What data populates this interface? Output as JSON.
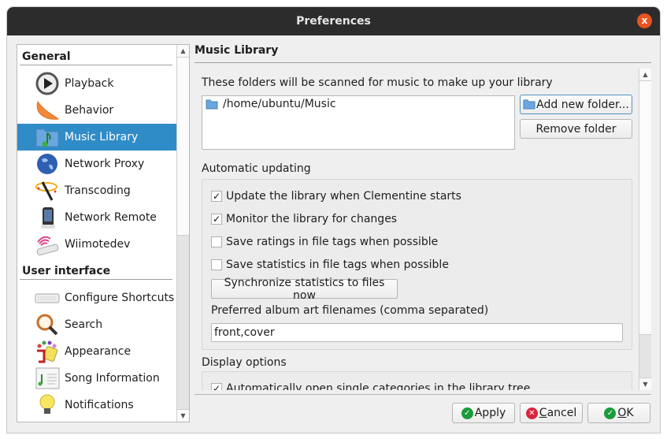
{
  "window": {
    "title": "Preferences",
    "close_label": "x"
  },
  "nav": {
    "groups": [
      {
        "label": "General",
        "items": [
          {
            "label": "Playback",
            "icon": "playback-icon"
          },
          {
            "label": "Behavior",
            "icon": "clementine-icon"
          },
          {
            "label": "Music Library",
            "icon": "music-folder-icon",
            "selected": true
          },
          {
            "label": "Network Proxy",
            "icon": "globe-icon"
          },
          {
            "label": "Transcoding",
            "icon": "magic-wand-icon"
          },
          {
            "label": "Network Remote",
            "icon": "phone-icon"
          },
          {
            "label": "Wiimotedev",
            "icon": "wiimote-icon"
          }
        ]
      },
      {
        "label": "User interface",
        "items": [
          {
            "label": "Configure Shortcuts",
            "icon": "keyboard-icon"
          },
          {
            "label": "Search",
            "icon": "magnifier-icon"
          },
          {
            "label": "Appearance",
            "icon": "paint-icon"
          },
          {
            "label": "Song Information",
            "icon": "song-info-icon"
          },
          {
            "label": "Notifications",
            "icon": "lightbulb-icon"
          }
        ]
      }
    ]
  },
  "page": {
    "title": "Music Library",
    "folders_label": "These folders will be scanned for music to make up your library",
    "folders": [
      "/home/ubuntu/Music"
    ],
    "add_folder_label": "Add new folder...",
    "remove_folder_label": "Remove folder",
    "auto_update": {
      "title": "Automatic updating",
      "options": [
        {
          "label": "Update the library when Clementine starts",
          "checked": true
        },
        {
          "label": "Monitor the library for changes",
          "checked": true
        },
        {
          "label": "Save ratings in file tags when possible",
          "checked": false
        },
        {
          "label": "Save statistics in file tags when possible",
          "checked": false
        }
      ],
      "sync_button": "Synchronize statistics to files now",
      "album_art_label": "Preferred album art filenames (comma separated)",
      "album_art_value": "front,cover"
    },
    "display": {
      "title": "Display options",
      "options": [
        {
          "label": "Automatically open single categories in the library tree",
          "checked": true
        }
      ]
    }
  },
  "footer": {
    "apply": "Apply",
    "cancel_prefix": "C",
    "cancel_rest": "ancel",
    "ok_prefix": "O",
    "ok_rest": "K"
  },
  "colors": {
    "accent": "#308cc6",
    "close": "#e95420",
    "ok_green": "#1a9c3a",
    "cancel_red": "#d9263d"
  }
}
